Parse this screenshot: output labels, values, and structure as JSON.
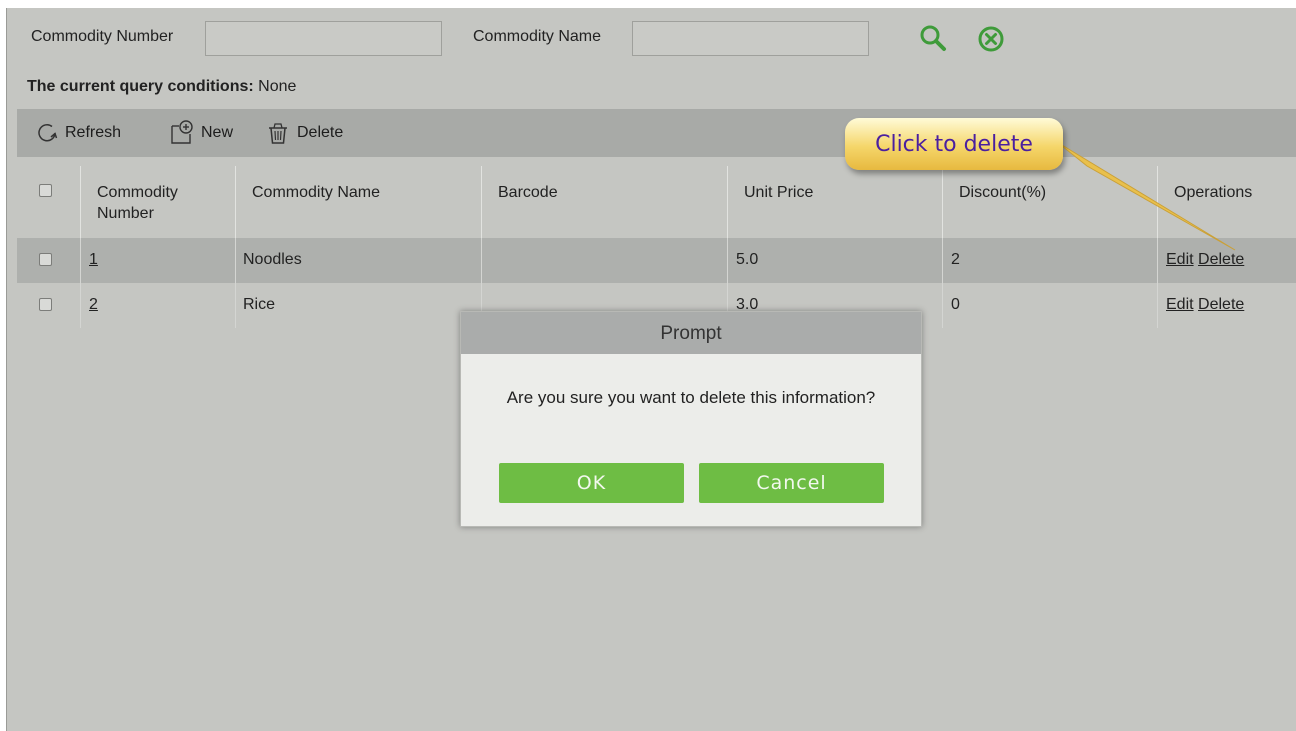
{
  "search": {
    "commodity_number_label": "Commodity Number",
    "commodity_number_value": "",
    "commodity_name_label": "Commodity Name",
    "commodity_name_value": "",
    "search_icon": "search-icon",
    "clear_icon": "clear-circle-icon"
  },
  "query": {
    "label": "The current query conditions:",
    "value": "None"
  },
  "toolbar": {
    "refresh_label": "Refresh",
    "new_label": "New",
    "delete_label": "Delete"
  },
  "table": {
    "headers": {
      "number": "Commodity Number",
      "name": "Commodity Name",
      "barcode": "Barcode",
      "unit_price": "Unit Price",
      "discount": "Discount(%)",
      "operations": "Operations"
    },
    "rows": [
      {
        "number": "1",
        "name": "Noodles",
        "barcode": "",
        "unit_price": "5.0",
        "discount": "2",
        "edit": "Edit",
        "delete": "Delete",
        "selected": true
      },
      {
        "number": "2",
        "name": "Rice",
        "barcode": "",
        "unit_price": "3.0",
        "discount": "0",
        "edit": "Edit",
        "delete": "Delete",
        "selected": false
      }
    ]
  },
  "callout": {
    "text": "Click to delete"
  },
  "dialog": {
    "title": "Prompt",
    "message": "Are you sure you want to delete this information?",
    "ok_label": "OK",
    "cancel_label": "Cancel"
  },
  "colors": {
    "accent_green": "#6ebd44",
    "icon_green": "#3f9b3a",
    "callout_text": "#4a1fa0"
  }
}
